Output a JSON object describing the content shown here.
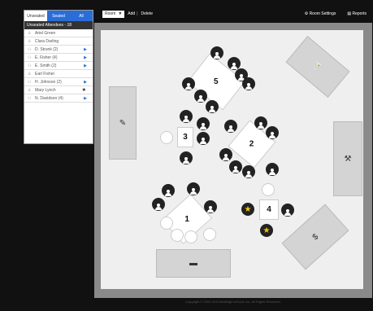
{
  "sidebar": {
    "tabs": [
      {
        "label": "Unseated",
        "active": true
      },
      {
        "label": "Seated",
        "active": false
      },
      {
        "label": "All",
        "active": false
      }
    ],
    "header": "Unseated Attendees - 18",
    "attendees": [
      {
        "name": "Ariel Green",
        "icon": "person-icon",
        "expand": false,
        "star": false
      },
      {
        "name": "Clara Darling",
        "icon": "person-icon",
        "expand": false,
        "star": false
      },
      {
        "name": "D. Strunk (2)",
        "icon": "group-icon",
        "expand": true,
        "star": false
      },
      {
        "name": "E. Fisher (4)",
        "icon": "group-icon",
        "expand": true,
        "star": false
      },
      {
        "name": "E. Smith (2)",
        "icon": "group-icon",
        "expand": true,
        "star": false
      },
      {
        "name": "Earl Fisher",
        "icon": "person-icon",
        "expand": false,
        "star": false
      },
      {
        "name": "H. Johnson (2)",
        "icon": "group-icon",
        "expand": true,
        "star": false
      },
      {
        "name": "Mary Lynch",
        "icon": "person-icon",
        "expand": false,
        "star": true
      },
      {
        "name": "N. Davidson (4)",
        "icon": "group-icon",
        "expand": true,
        "star": false
      }
    ]
  },
  "toolbar": {
    "room_label": "Room",
    "add_label": "Add",
    "delete_label": "Delete",
    "room_settings_label": "Room Settings",
    "reports_label": "Reports"
  },
  "tables": [
    {
      "number": "5"
    },
    {
      "number": "3"
    },
    {
      "number": "2"
    },
    {
      "number": "4"
    },
    {
      "number": "1"
    }
  ],
  "footer": "Copyright © 2009-2015 BiddingForGood, Inc. All Rights Reserved."
}
